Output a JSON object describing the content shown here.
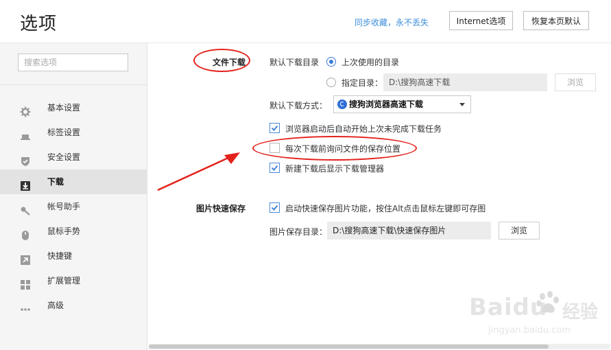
{
  "header": {
    "title": "选项",
    "sync_link": "同步收藏，永不丢失",
    "internet_button": "Internet选项",
    "restore_button": "恢复本页默认"
  },
  "sidebar": {
    "search_placeholder": "搜索选项",
    "items": [
      {
        "label": "基本设置",
        "icon": "gear-icon"
      },
      {
        "label": "标签设置",
        "icon": "tab-icon"
      },
      {
        "label": "安全设置",
        "icon": "shield-icon"
      },
      {
        "label": "下载",
        "icon": "download-icon",
        "active": true
      },
      {
        "label": "帐号助手",
        "icon": "key-icon"
      },
      {
        "label": "鼠标手势",
        "icon": "mouse-icon"
      },
      {
        "label": "快捷键",
        "icon": "shortcut-arrow-icon"
      },
      {
        "label": "扩展管理",
        "icon": "grid-icon"
      },
      {
        "label": "高级",
        "icon": "more-dots-icon"
      }
    ]
  },
  "download": {
    "section_label": "文件下载",
    "default_dir_label": "默认下载目录",
    "radio_last_used": "上次使用的目录",
    "radio_specify": "指定目录：",
    "specify_path": "D:\\搜狗高速下载",
    "browse_label": "浏览",
    "method_label": "默认下载方式：",
    "method_value": "搜狗浏览器高速下载",
    "checkbox_resume": "浏览器启动后自动开始上次未完成下载任务",
    "checkbox_ask_location": "每次下载前询问文件的保存位置",
    "checkbox_show_manager": "新建下载后显示下载管理器"
  },
  "image_save": {
    "section_label": "图片快速保存",
    "checkbox_enable": "启动快速保存图片功能，按住Alt点击鼠标左键即可存图",
    "dir_label": "图片保存目录：",
    "dir_value": "D:\\搜狗高速下载\\快速保存图片",
    "browse_label": "浏览"
  },
  "watermark": {
    "brand_latin": "Baidu",
    "brand_cn": "经验",
    "url": "jingyan.baidu.com"
  },
  "colors": {
    "accent": "#3a7bd5",
    "link": "#3b8ed9",
    "annotation_red": "#e4211b",
    "sidebar_bg": "#f5f5f5",
    "active_item_bg": "#e3e3e3"
  }
}
